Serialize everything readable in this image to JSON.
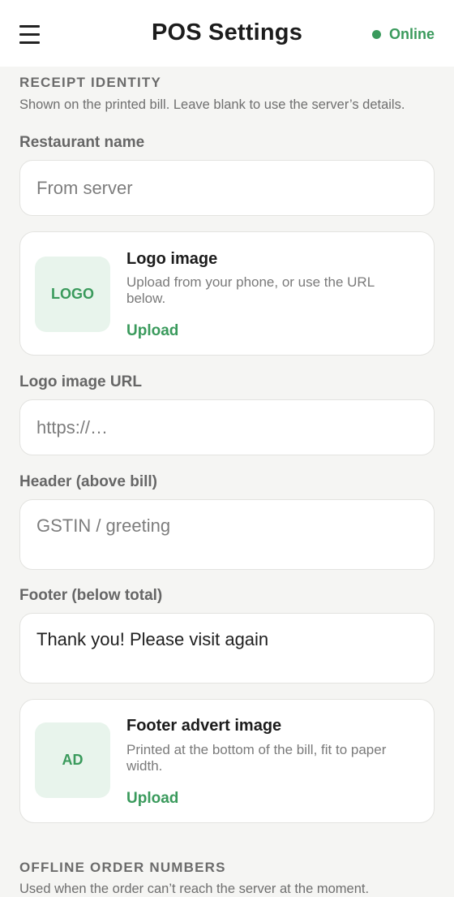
{
  "header": {
    "title": "POS Settings",
    "status": "Online",
    "status_color": "#3a9a5c",
    "menu_icon": "hamburger-menu-icon"
  },
  "receipt_identity": {
    "title": "RECEIPT IDENTITY",
    "description": "Shown on the printed bill. Leave blank to use the server’s details.",
    "restaurant_name": {
      "label": "Restaurant name",
      "placeholder": "From server",
      "value": ""
    },
    "logo_card": {
      "thumb_text": "LOGO",
      "title": "Logo image",
      "description": "Upload from your phone, or use the URL below.",
      "action": "Upload"
    },
    "logo_url": {
      "label": "Logo image URL",
      "placeholder": "https://…",
      "value": ""
    },
    "header_text": {
      "label": "Header (above bill)",
      "placeholder": "GSTIN / greeting",
      "value": ""
    },
    "footer_text": {
      "label": "Footer (below total)",
      "placeholder": "",
      "value": "Thank you! Please visit again"
    },
    "advert_card": {
      "thumb_text": "AD",
      "title": "Footer advert image",
      "description": "Printed at the bottom of the bill, fit to paper width.",
      "action": "Upload"
    }
  },
  "offline_orders": {
    "title": "OFFLINE ORDER NUMBERS",
    "description": "Used when the order can’t reach the server at the moment."
  }
}
